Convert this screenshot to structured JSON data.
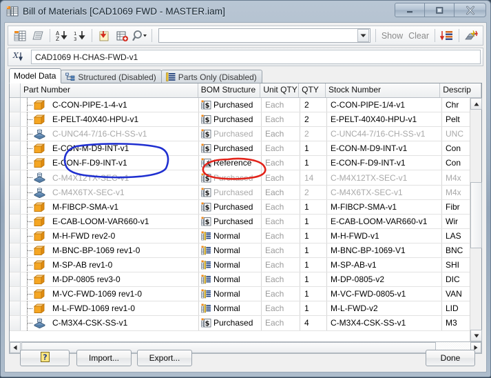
{
  "window": {
    "title": "Bill of Materials [CAD1069 FWD - MASTER.iam]",
    "app_icon": "bom-table-icon",
    "minimize_label": "–",
    "maximize_label": "□",
    "close_label": "✕"
  },
  "toolbar": {
    "buttons": [
      {
        "name": "bom-view-properties-icon",
        "glyph": "bom-properties"
      },
      {
        "name": "bom-export-sheet-icon",
        "glyph": "sheet"
      },
      {
        "name": "sort-ascending-icon",
        "glyph": "az-down"
      },
      {
        "name": "sort-descending-icon",
        "glyph": "13-down"
      },
      {
        "name": "renumber-items-icon",
        "glyph": "note-arrow"
      },
      {
        "name": "add-custom-part-icon",
        "glyph": "table-plus"
      },
      {
        "name": "find-icon",
        "glyph": "magnifier"
      }
    ],
    "filter_value": "",
    "show_label": "Show",
    "clear_label": "Clear",
    "right_buttons": [
      {
        "name": "bom-structure-icon",
        "glyph": "struct"
      },
      {
        "name": "part-number-merge-icon",
        "glyph": "merge"
      }
    ]
  },
  "path_row": {
    "icon": "rename-xz-icon",
    "value": "CAD1069 H-CHAS-FWD-v1"
  },
  "tabs": [
    {
      "label": "Model Data",
      "active": true,
      "icon": null
    },
    {
      "label": "Structured (Disabled)",
      "active": false,
      "icon": "structured-tree-icon"
    },
    {
      "label": "Parts Only (Disabled)",
      "active": false,
      "icon": "parts-only-list-icon"
    }
  ],
  "grid": {
    "columns": [
      {
        "key": "part_number",
        "label": "Part Number"
      },
      {
        "key": "bom_structure",
        "label": "BOM Structure"
      },
      {
        "key": "unit_qty",
        "label": "Unit QTY"
      },
      {
        "key": "qty",
        "label": "QTY"
      },
      {
        "key": "stock_number",
        "label": "Stock Number"
      },
      {
        "key": "description",
        "label": "Descrip"
      }
    ],
    "rows": [
      {
        "icon": "part-box-icon",
        "part_number": "C-CON-PIPE-1-4-v1",
        "bom_structure": "Purchased",
        "bs_icon": "purchased-icon",
        "unit_qty": "Each",
        "qty": "2",
        "stock_number": "C-CON-PIPE-1/4-v1",
        "description": "Chr",
        "dimmed": false
      },
      {
        "icon": "part-box-icon",
        "part_number": "E-PELT-40X40-HPU-v1",
        "bom_structure": "Purchased",
        "bs_icon": "purchased-icon",
        "unit_qty": "Each",
        "qty": "2",
        "stock_number": "E-PELT-40X40-HPU-v1",
        "description": "Pelt",
        "dimmed": false
      },
      {
        "icon": "fastener-icon",
        "part_number": "C-UNC44-7/16-CH-SS-v1",
        "bom_structure": "Purchased",
        "bs_icon": "purchased-icon",
        "unit_qty": "Each",
        "qty": "2",
        "stock_number": "C-UNC44-7/16-CH-SS-v1",
        "description": "UNC",
        "dimmed": true
      },
      {
        "icon": "part-box-icon",
        "part_number": "E-CON-M-D9-INT-v1",
        "bom_structure": "Purchased",
        "bs_icon": "purchased-icon",
        "unit_qty": "Each",
        "qty": "1",
        "stock_number": "E-CON-M-D9-INT-v1",
        "description": "Con",
        "dimmed": false
      },
      {
        "icon": "part-box-icon",
        "part_number": "E-CON-F-D9-INT-v1",
        "bom_structure": "Reference",
        "bs_icon": "reference-icon",
        "unit_qty": "Each",
        "qty": "1",
        "stock_number": "E-CON-F-D9-INT-v1",
        "description": "Con",
        "dimmed": false
      },
      {
        "icon": "fastener-icon",
        "part_number": "C-M4X12TX-SEC-v1",
        "bom_structure": "Purchased",
        "bs_icon": "purchased-icon",
        "unit_qty": "Each",
        "qty": "14",
        "stock_number": "C-M4X12TX-SEC-v1",
        "description": "M4x",
        "dimmed": true
      },
      {
        "icon": "fastener-icon",
        "part_number": "C-M4X6TX-SEC-v1",
        "bom_structure": "Purchased",
        "bs_icon": "purchased-icon",
        "unit_qty": "Each",
        "qty": "2",
        "stock_number": "C-M4X6TX-SEC-v1",
        "description": "M4x",
        "dimmed": true
      },
      {
        "icon": "part-box-icon",
        "part_number": "M-FIBCP-SMA-v1",
        "bom_structure": "Purchased",
        "bs_icon": "purchased-icon",
        "unit_qty": "Each",
        "qty": "1",
        "stock_number": "M-FIBCP-SMA-v1",
        "description": "Fibr",
        "dimmed": false
      },
      {
        "icon": "part-box-icon",
        "part_number": "E-CAB-LOOM-VAR660-v1",
        "bom_structure": "Purchased",
        "bs_icon": "purchased-icon",
        "unit_qty": "Each",
        "qty": "1",
        "stock_number": "E-CAB-LOOM-VAR660-v1",
        "description": "Wir",
        "dimmed": false
      },
      {
        "icon": "part-box-icon",
        "part_number": "M-H-FWD rev2-0",
        "bom_structure": "Normal",
        "bs_icon": "normal-icon",
        "unit_qty": "Each",
        "qty": "1",
        "stock_number": "M-H-FWD-v1",
        "description": "LAS",
        "dimmed": false
      },
      {
        "icon": "part-box-icon",
        "part_number": "M-BNC-BP-1069 rev1-0",
        "bom_structure": "Normal",
        "bs_icon": "normal-icon",
        "unit_qty": "Each",
        "qty": "1",
        "stock_number": "M-BNC-BP-1069-V1",
        "description": "BNC",
        "dimmed": false
      },
      {
        "icon": "part-box-icon",
        "part_number": "M-SP-AB rev1-0",
        "bom_structure": "Normal",
        "bs_icon": "normal-icon",
        "unit_qty": "Each",
        "qty": "1",
        "stock_number": "M-SP-AB-v1",
        "description": "SHI",
        "dimmed": false
      },
      {
        "icon": "part-box-icon",
        "part_number": "M-DP-0805 rev3-0",
        "bom_structure": "Normal",
        "bs_icon": "normal-icon",
        "unit_qty": "Each",
        "qty": "1",
        "stock_number": "M-DP-0805-v2",
        "description": "DIC",
        "dimmed": false
      },
      {
        "icon": "part-box-icon",
        "part_number": "M-VC-FWD-1069 rev1-0",
        "bom_structure": "Normal",
        "bs_icon": "normal-icon",
        "unit_qty": "Each",
        "qty": "1",
        "stock_number": "M-VC-FWD-0805-v1",
        "description": "VAN",
        "dimmed": false
      },
      {
        "icon": "part-box-icon",
        "part_number": "M-L-FWD-1069 rev1-0",
        "bom_structure": "Normal",
        "bs_icon": "normal-icon",
        "unit_qty": "Each",
        "qty": "1",
        "stock_number": "M-L-FWD-v2",
        "description": "LID",
        "dimmed": false
      },
      {
        "icon": "fastener-icon",
        "part_number": "C-M3X4-CSK-SS-v1",
        "bom_structure": "Purchased",
        "bs_icon": "purchased-icon",
        "unit_qty": "Each",
        "qty": "4",
        "stock_number": "C-M3X4-CSK-SS-v1",
        "description": "M3",
        "dimmed": false
      }
    ]
  },
  "footer": {
    "help_label": "?",
    "import_label": "Import...",
    "export_label": "Export...",
    "done_label": "Done"
  },
  "annotations": [
    {
      "name": "blue-ellipse-highlight",
      "shape": "ellipse",
      "color": "#1f2fd0",
      "target": "E-CON-M-D9-INT-v1 and E-CON-F-D9-INT-v1 part numbers"
    },
    {
      "name": "red-ellipse-highlight",
      "shape": "ellipse",
      "color": "#e2231a",
      "target": "Reference BOM structure cell"
    }
  ],
  "colors": {
    "blue_annotation": "#1f2fd0",
    "red_annotation": "#e2231a",
    "part_icon_orange": "#f0a020",
    "title_bar": "#a7b7c8"
  }
}
